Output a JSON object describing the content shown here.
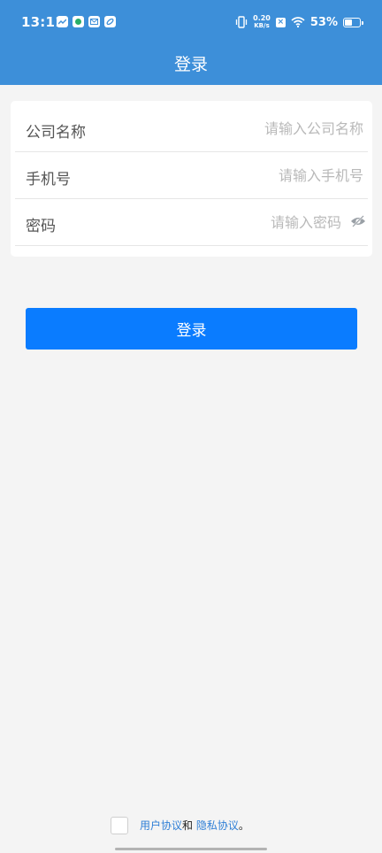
{
  "status_bar": {
    "time": "13:11",
    "net_speed_value": "0.20",
    "net_speed_unit": "KB/s",
    "battery_percent": "53%",
    "battery_level": 0.53,
    "icons": [
      "chart-app-icon",
      "wechat-icon",
      "mail-icon",
      "leaf-app-icon",
      "vibrate-icon",
      "sim-x-icon",
      "wifi-icon",
      "battery-icon"
    ]
  },
  "header": {
    "title": "登录"
  },
  "form": {
    "company": {
      "label": "公司名称",
      "placeholder": "请输入公司名称",
      "value": ""
    },
    "phone": {
      "label": "手机号",
      "placeholder": "请输入手机号",
      "value": ""
    },
    "password": {
      "label": "密码",
      "placeholder": "请输入密码",
      "value": ""
    }
  },
  "actions": {
    "login_label": "登录"
  },
  "agreement": {
    "user_agreement": "用户协议",
    "and_text": "和",
    "privacy_agreement": "隐私协议",
    "end_punct": "。"
  },
  "colors": {
    "header": "#3d8fd9",
    "button": "#0a7cff",
    "link": "#2f7fd6",
    "background": "#f4f4f4"
  }
}
